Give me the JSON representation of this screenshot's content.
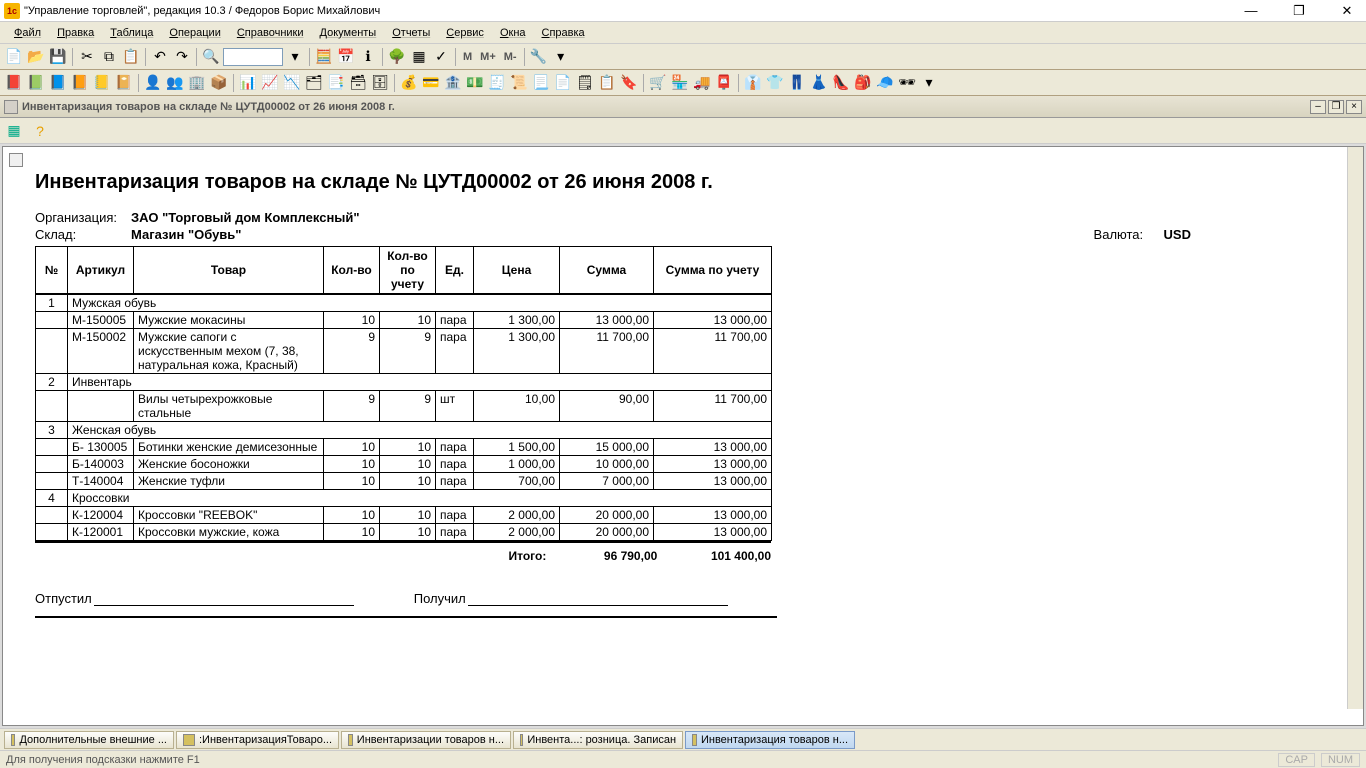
{
  "window": {
    "title": "\"Управление торговлей\", редакция 10.3 / Федоров Борис Михайлович"
  },
  "menu": {
    "file": "Файл",
    "edit": "Правка",
    "table": "Таблица",
    "operations": "Операции",
    "refs": "Справочники",
    "docs": "Документы",
    "reports": "Отчеты",
    "service": "Сервис",
    "windows": "Окна",
    "help": "Справка"
  },
  "toolbar": {
    "m": "M",
    "mplus": "M+",
    "mminus": "M-"
  },
  "doc_tab": {
    "title": "Инвентаризация товаров на складе № ЦУТД00002 от 26 июня 2008 г."
  },
  "report": {
    "title": "Инвентаризация товаров на складе № ЦУТД00002 от 26 июня 2008 г.",
    "org_label": "Организация:",
    "org_value": "ЗАО \"Торговый дом Комплексный\"",
    "sklad_label": "Склад:",
    "sklad_value": "Магазин \"Обувь\"",
    "currency_label": "Валюта:",
    "currency_value": "USD",
    "headers": {
      "num": "№",
      "article": "Артикул",
      "product": "Товар",
      "qty": "Кол-во",
      "qty_acc": "Кол-во по учету",
      "unit": "Ед.",
      "price": "Цена",
      "sum": "Сумма",
      "sum_acc": "Сумма по учету"
    },
    "groups": [
      {
        "num": "1",
        "name": "Мужская обувь",
        "rows": [
          {
            "article": "М-150005",
            "product": "Мужские мокасины",
            "qty": "10",
            "qty_acc": "10",
            "unit": "пара",
            "price": "1 300,00",
            "sum": "13 000,00",
            "sum_acc": "13 000,00"
          },
          {
            "article": "М-150002",
            "product": "Мужские сапоги с искусственным мехом (7, 38, натуральная кожа, Красный)",
            "qty": "9",
            "qty_acc": "9",
            "unit": "пара",
            "price": "1 300,00",
            "sum": "11 700,00",
            "sum_acc": "11 700,00"
          }
        ]
      },
      {
        "num": "2",
        "name": "Инвентарь",
        "rows": [
          {
            "article": "",
            "product": "Вилы четырехрожковые стальные",
            "qty": "9",
            "qty_acc": "9",
            "unit": "шт",
            "price": "10,00",
            "sum": "90,00",
            "sum_acc": "11 700,00"
          }
        ]
      },
      {
        "num": "3",
        "name": "Женская обувь",
        "rows": [
          {
            "article": "Б- 130005",
            "product": "Ботинки женские демисезонные",
            "qty": "10",
            "qty_acc": "10",
            "unit": "пара",
            "price": "1 500,00",
            "sum": "15 000,00",
            "sum_acc": "13 000,00"
          },
          {
            "article": "Б-140003",
            "product": "Женские босоножки",
            "qty": "10",
            "qty_acc": "10",
            "unit": "пара",
            "price": "1 000,00",
            "sum": "10 000,00",
            "sum_acc": "13 000,00"
          },
          {
            "article": "Т-140004",
            "product": "Женские туфли",
            "qty": "10",
            "qty_acc": "10",
            "unit": "пара",
            "price": "700,00",
            "sum": "7 000,00",
            "sum_acc": "13 000,00"
          }
        ]
      },
      {
        "num": "4",
        "name": "Кроссовки",
        "rows": [
          {
            "article": "К-120004",
            "product": "Кроссовки \"REEBOK\"",
            "qty": "10",
            "qty_acc": "10",
            "unit": "пара",
            "price": "2 000,00",
            "sum": "20 000,00",
            "sum_acc": "13 000,00"
          },
          {
            "article": "К-120001",
            "product": "Кроссовки мужские, кожа",
            "qty": "10",
            "qty_acc": "10",
            "unit": "пара",
            "price": "2 000,00",
            "sum": "20 000,00",
            "sum_acc": "13 000,00"
          }
        ]
      }
    ],
    "totals_label": "Итого:",
    "totals_sum": "96 790,00",
    "totals_sum_acc": "101 400,00",
    "sig_sent": "Отпустил",
    "sig_recv": "Получил"
  },
  "taskbar": {
    "t1": "Дополнительные внешние ...",
    "t2": ":ИнвентаризацияТоваро...",
    "t3": "Инвентаризации товаров н...",
    "t4": "Инвента...: розница. Записан",
    "t5": "Инвентаризация товаров н..."
  },
  "status": {
    "hint": "Для получения подсказки нажмите F1",
    "cap": "CAP",
    "num": "NUM"
  }
}
